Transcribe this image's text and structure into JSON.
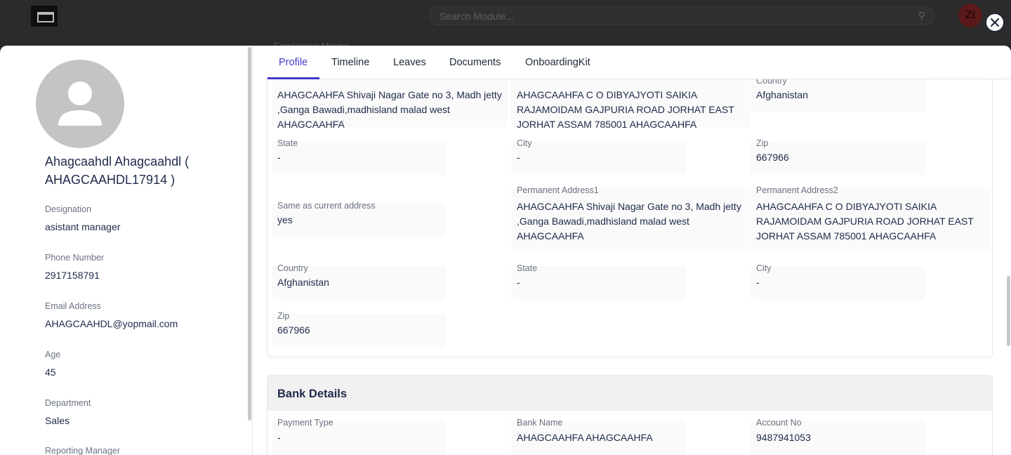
{
  "background": {
    "search_placeholder": "Search Module...",
    "avatar_text": "Zi",
    "breadcrumb": "Employees Master"
  },
  "tabs": [
    "Profile",
    "Timeline",
    "Leaves",
    "Documents",
    "OnboardingKit"
  ],
  "profile": {
    "name": "Ahagcaahdl Ahagcaahdl ( AHAGCAAHDL17914 )",
    "fields": [
      {
        "label": "Designation",
        "value": "asistant manager"
      },
      {
        "label": "Phone Number",
        "value": "2917158791"
      },
      {
        "label": "Email Address",
        "value": "AHAGCAAHDL@yopmail.com"
      },
      {
        "label": "Age",
        "value": "45"
      },
      {
        "label": "Department",
        "value": "Sales"
      },
      {
        "label": "Reporting Manager",
        "value": ""
      }
    ]
  },
  "address": {
    "current_address1": "AHAGCAAHFA Shivaji Nagar Gate no 3, Madh jetty ,Ganga Bawadi,madhisland malad west AHAGCAAHFA",
    "current_address2": "AHAGCAAHFA C O DIBYAJYOTI SAIKIA RAJAMOIDAM GAJPURIA ROAD JORHAT EAST JORHAT ASSAM 785001 AHAGCAAHFA",
    "country_label": "Country",
    "country": "Afghanistan",
    "state_label": "State",
    "state": "-",
    "city_label": "City",
    "city": "-",
    "zip_label": "Zip",
    "zip": "667966",
    "same_label": "Same as current address",
    "same": "yes",
    "perm1_label": "Permanent Address1",
    "perm1": "AHAGCAAHFA Shivaji Nagar Gate no 3, Madh jetty ,Ganga Bawadi,madhisland malad west AHAGCAAHFA",
    "perm2_label": "Permanent Address2",
    "perm2": "AHAGCAAHFA C O DIBYAJYOTI SAIKIA RAJAMOIDAM GAJPURIA ROAD JORHAT EAST JORHAT ASSAM 785001 AHAGCAAHFA",
    "pcountry": "Afghanistan",
    "pstate": "-",
    "pcity": "-",
    "pzip": "667966"
  },
  "bank": {
    "title": "Bank Details",
    "payment_type_label": "Payment Type",
    "payment_type": "-",
    "bank_name_label": "Bank Name",
    "bank_name": "AHAGCAAHFA AHAGCAAHFA",
    "account_no_label": "Account No",
    "account_no": "9487941053"
  }
}
